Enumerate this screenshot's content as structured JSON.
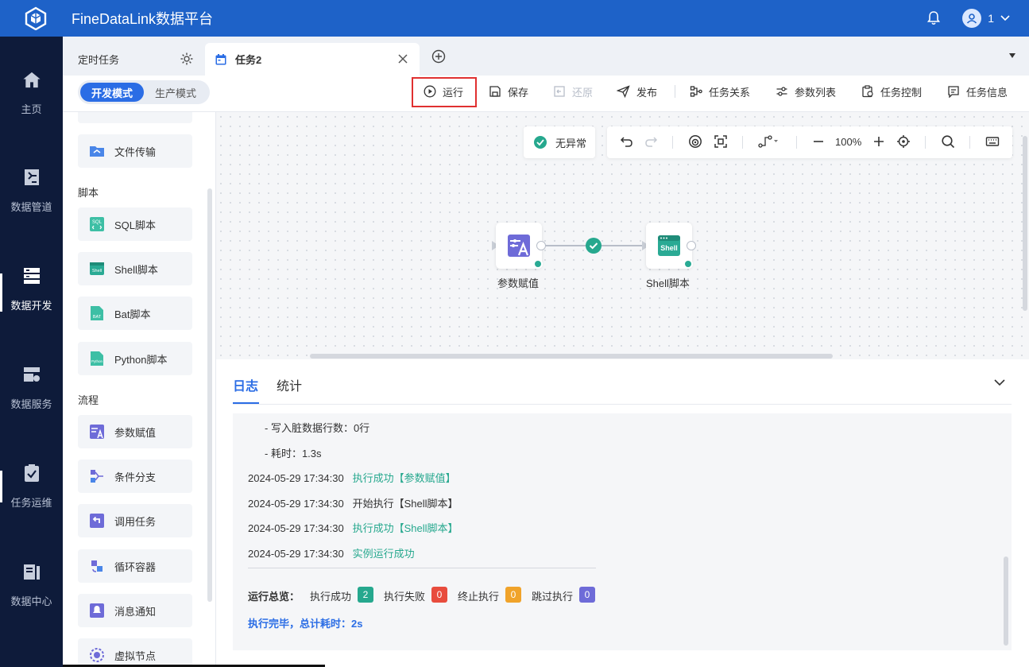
{
  "app": {
    "title": "FineDataLink数据平台",
    "user": "1"
  },
  "nav": [
    {
      "label": "主页",
      "icon": "home-icon"
    },
    {
      "label": "数据管道",
      "icon": "pipeline-icon"
    },
    {
      "label": "数据开发",
      "icon": "data-dev-icon",
      "active": true
    },
    {
      "label": "数据服务",
      "icon": "data-service-icon"
    },
    {
      "label": "任务运维",
      "icon": "task-ops-icon"
    },
    {
      "label": "数据中心",
      "icon": "data-center-icon"
    }
  ],
  "tabs": {
    "t1": "定时任务",
    "t2": "任务2"
  },
  "modes": {
    "dev": "开发模式",
    "prod": "生产模式"
  },
  "toolbar": {
    "run": "运行",
    "save": "保存",
    "restore": "还原",
    "publish": "发布",
    "relations": "任务关系",
    "params": "参数列表",
    "control": "任务控制",
    "info": "任务信息"
  },
  "palette": {
    "file_transfer": "文件传输",
    "cat_script": "脚本",
    "sql": "SQL脚本",
    "shell": "Shell脚本",
    "bat": "Bat脚本",
    "python": "Python脚本",
    "cat_flow": "流程",
    "param_assign": "参数赋值",
    "branch": "条件分支",
    "call_task": "调用任务",
    "loop": "循环容器",
    "notify": "消息通知",
    "virtual": "虚拟节点",
    "icon_text": {
      "sql": "SQL",
      "shell": "Shell",
      "bat": "BAT",
      "python": "Python"
    }
  },
  "canvas": {
    "status": "无异常",
    "zoom": "100%",
    "node1": "参数赋值",
    "node2": "Shell脚本",
    "node2_icon_text": "Shell"
  },
  "log": {
    "tab_log": "日志",
    "tab_stats": "统计",
    "lines": [
      {
        "time": "",
        "text": "- 写入脏数据行数：0行",
        "status": ""
      },
      {
        "time": "",
        "text": "- 耗时：1.3s",
        "status": ""
      },
      {
        "time": "2024-05-29 17:34:30",
        "text": "",
        "status": "执行成功【参数赋值】"
      },
      {
        "time": "2024-05-29 17:34:30",
        "text": "开始执行【Shell脚本】",
        "status": ""
      },
      {
        "time": "2024-05-29 17:34:30",
        "text": "",
        "status": "执行成功【Shell脚本】"
      },
      {
        "time": "2024-05-29 17:34:30",
        "text": "",
        "status": "实例运行成功"
      }
    ],
    "summary_label": "运行总览：",
    "success_label": "执行成功",
    "success_count": "2",
    "fail_label": "执行失败",
    "fail_count": "0",
    "stop_label": "终止执行",
    "stop_count": "0",
    "skip_label": "跳过执行",
    "skip_count": "0",
    "done": "执行完毕，总计耗时：2s"
  },
  "colors": {
    "brand": "#1e62c8",
    "nav_bg": "#0e1b3a",
    "accent": "#2b6de5",
    "success": "#26a88e",
    "fail": "#e84c3d",
    "stop": "#f0a32a",
    "skip": "#6e6bd8"
  }
}
